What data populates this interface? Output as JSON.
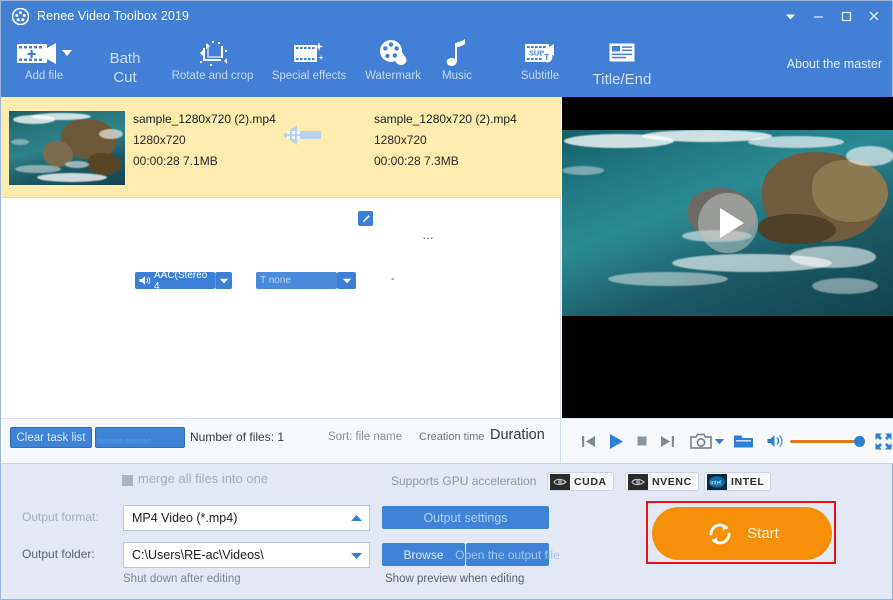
{
  "window": {
    "title": "Renee Video Toolbox 2019",
    "logo_icon": "film-reel-icon",
    "controls": [
      {
        "name": "menu-chevron-down-icon",
        "label": "▼"
      },
      {
        "name": "minimize-icon",
        "label": "—"
      },
      {
        "name": "maximize-icon",
        "label": "□"
      },
      {
        "name": "close-icon",
        "label": "✕"
      }
    ],
    "header_color": "#4180d4"
  },
  "toolbar": {
    "items": [
      {
        "label": "Add file",
        "icon": "add-film-icon",
        "has_dropdown": true,
        "big": false
      },
      {
        "label": "Bath\nCut",
        "icon": "none",
        "has_dropdown": false,
        "big": true
      },
      {
        "label": "Rotate and crop",
        "icon": "rotate-crop-icon",
        "has_dropdown": false,
        "big": false
      },
      {
        "label": "Special effects",
        "icon": "special-effects-icon",
        "has_dropdown": false,
        "big": false
      },
      {
        "label": "Watermark",
        "icon": "watermark-icon",
        "has_dropdown": false,
        "big": false
      },
      {
        "label": "Music",
        "icon": "music-note-icon",
        "has_dropdown": false,
        "big": false
      },
      {
        "label": "Subtitle",
        "icon": "subtitle-icon",
        "has_dropdown": false,
        "big": false
      },
      {
        "label": "Title/End",
        "icon": "title-end-icon",
        "has_dropdown": false,
        "big": true
      }
    ],
    "about_label": "About the master"
  },
  "file_row": {
    "source": {
      "filename": "sample_1280x720 (2).mp4",
      "resolution": "1280x720",
      "duration_size": "00:00:28  7.1MB"
    },
    "output": {
      "filename": "sample_1280x720 (2).mp4",
      "resolution": "1280x720",
      "more": "…",
      "duration_size": "00:00:28  7.3MB",
      "edit_badge_icon": "pencil-edit-icon"
    },
    "arrow_icon": "right-arrow-icon",
    "audio_chip": {
      "label": "AAC(Stereo 4",
      "icon": "speaker-icon",
      "arrow_icon": "chevron-down-icon"
    },
    "subtitle_chip": {
      "label": "T none",
      "arrow_icon": "chevron-down-icon"
    },
    "third_value": "-",
    "row_color": "#fdecae"
  },
  "list_footer": {
    "clear_label": "Clear task list",
    "remove_label": "Remove selected",
    "number_of_files": "Number of files: 1",
    "sort_label": "Sort: file name",
    "creation_time_label": "Creation time",
    "duration_label": "Duration"
  },
  "player": {
    "play_overlay_icon": "play-triangle-icon",
    "controls": [
      {
        "name": "previous-frame-icon"
      },
      {
        "name": "play-icon"
      },
      {
        "name": "stop-icon"
      },
      {
        "name": "next-frame-icon"
      },
      {
        "name": "snapshot-camera-icon"
      },
      {
        "name": "snapshot-dropdown-icon"
      },
      {
        "name": "open-folder-icon"
      },
      {
        "name": "volume-icon"
      },
      {
        "name": "fullscreen-icon"
      }
    ],
    "volume_level": "100",
    "volume_color": "#e07b18"
  },
  "settings": {
    "merge_label": "merge all files into one",
    "output_format_label": "Output format:",
    "output_format_value": "MP4 Video (*.mp4)",
    "output_folder_label": "Output folder:",
    "output_folder_value": "C:\\Users\\RE-ac\\Videos\\",
    "shutdown_label": "Shut down after editing",
    "gpu_text": "Supports GPU acceleration",
    "gpu_badges": [
      {
        "name": "CUDA",
        "logo": "nvidia-eye-icon"
      },
      {
        "name": "NVENC",
        "logo": "nvidia-eye-icon"
      },
      {
        "name": "INTEL",
        "logo": "intel-icon"
      }
    ],
    "output_settings_label": "Output settings",
    "browse_label": "Browse",
    "open_output_label": "Open the output file",
    "show_preview_label": "Show preview when editing",
    "start_label": "Start",
    "start_icon": "refresh-convert-icon",
    "start_color": "#f79009",
    "highlight_color": "#e81313"
  }
}
